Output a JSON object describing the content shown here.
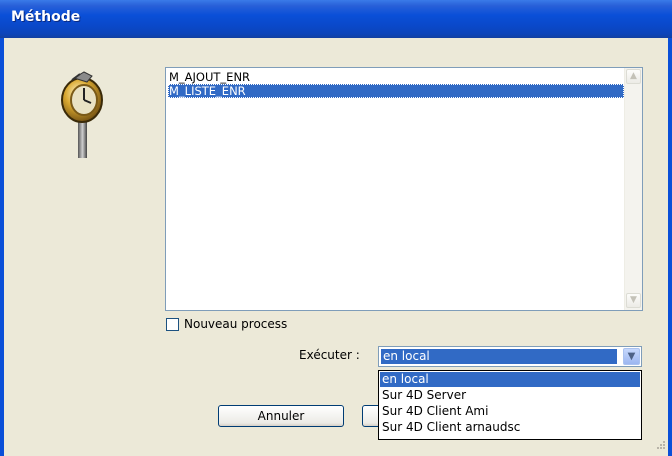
{
  "window": {
    "title": "Méthode"
  },
  "methods_list": {
    "items": [
      {
        "label": "M_AJOUT_ENR",
        "selected": false
      },
      {
        "label": "M_LISTE_ENR",
        "selected": true
      }
    ]
  },
  "options": {
    "new_process_label": "Nouveau process",
    "new_process_checked": false
  },
  "execute": {
    "label": "Exécuter :",
    "selected_value": "en local",
    "options": [
      "en local",
      "Sur 4D Server",
      "Sur 4D Client Ami",
      "Sur 4D Client arnaudsc"
    ]
  },
  "buttons": {
    "cancel": "Annuler"
  },
  "icons": {
    "method_icon": "clock-method-icon",
    "scroll_up": "scroll-up-arrow-icon",
    "scroll_down": "scroll-down-arrow-icon",
    "combo_arrow": "chevron-down-icon",
    "resize_grip": "resize-grip-icon"
  },
  "colors": {
    "title_bar": "#0a4fd8",
    "selection": "#316ac5",
    "dialog_bg": "#ece9d8"
  }
}
